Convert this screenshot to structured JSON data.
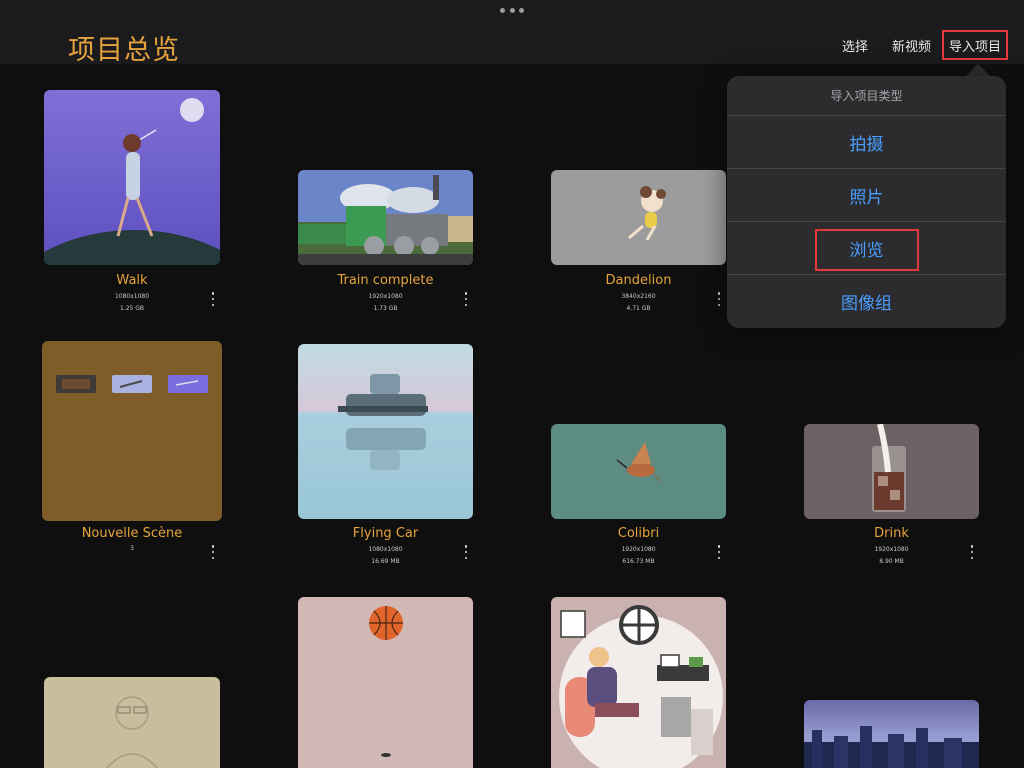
{
  "nav": {
    "title": "项目总览",
    "select_label": "选择",
    "new_video_label": "新视频",
    "import_label": "导入项目"
  },
  "popover": {
    "header": "导入项目类型",
    "items": [
      "拍摄",
      "照片",
      "浏览",
      "图像组"
    ]
  },
  "projects": [
    {
      "title": "Walk",
      "size": "1080x1080",
      "file": "1.25 GB"
    },
    {
      "title": "Train complete",
      "size": "1920x1080",
      "file": "1.73 GB"
    },
    {
      "title": "Dandelion",
      "size": "3840x2160",
      "file": "4.71 GB"
    },
    {
      "title": "Nouvelle Scène",
      "size": "3",
      "file": ""
    },
    {
      "title": "Flying Car",
      "size": "1080x1080",
      "file": "16.69 MB"
    },
    {
      "title": "Colibri",
      "size": "1920x1080",
      "file": "616.73 MB"
    },
    {
      "title": "Drink",
      "size": "1920x1080",
      "file": "8.90 MB"
    }
  ],
  "colors": {
    "accent": "#e6a33c",
    "link": "#4a9eff",
    "highlight": "#e5393b"
  }
}
